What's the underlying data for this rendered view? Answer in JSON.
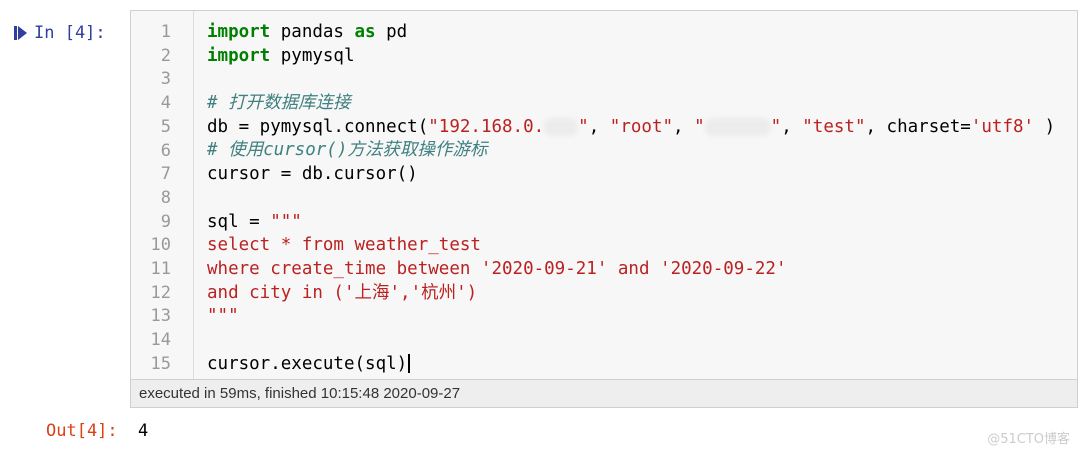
{
  "input_prompt": "In [4]:",
  "output_prompt": "Out[4]:",
  "output_value": "4",
  "line_numbers": [
    "1",
    "2",
    "3",
    "4",
    "5",
    "6",
    "7",
    "8",
    "9",
    "10",
    "11",
    "12",
    "13",
    "14",
    "15"
  ],
  "code": {
    "l1": {
      "kw1": "import",
      "a": " pandas ",
      "kw2": "as",
      "b": " pd"
    },
    "l2": {
      "kw": "import",
      "a": " pymysql"
    },
    "l4": {
      "comment": "# 打开数据库连接"
    },
    "l5": {
      "a": "db = pymysql.connect(",
      "s1": "\"192.168.0.",
      "s1_end": "\"",
      "c1": ", ",
      "s2": "\"root\"",
      "c2": ", ",
      "s3": "\"",
      "s3_end": "\"",
      "c3": ", ",
      "s4": "\"test\"",
      "c4": ", charset=",
      "s5": "'utf8'",
      "end": " )"
    },
    "l6": {
      "comment": "# 使用cursor()方法获取操作游标"
    },
    "l7": {
      "a": "cursor = db.cursor()"
    },
    "l9": {
      "a": "sql = ",
      "s": "\"\"\""
    },
    "l10": {
      "s": "select * from weather_test"
    },
    "l11": {
      "s": "where create_time between '2020-09-21' and '2020-09-22'"
    },
    "l12": {
      "s": "and city in ('上海','杭州')"
    },
    "l13": {
      "s": "\"\"\""
    },
    "l15": {
      "a": "cursor.execute(sql)"
    }
  },
  "status_text": "executed in 59ms, finished 10:15:48 2020-09-27",
  "watermark": "@51CTO博客",
  "colors": {
    "keyword": "#008000",
    "string": "#ba2121",
    "comment": "#408080",
    "in_prompt": "#303f9f",
    "out_prompt": "#d84315"
  },
  "icons": {
    "run": "run-cell-icon"
  }
}
